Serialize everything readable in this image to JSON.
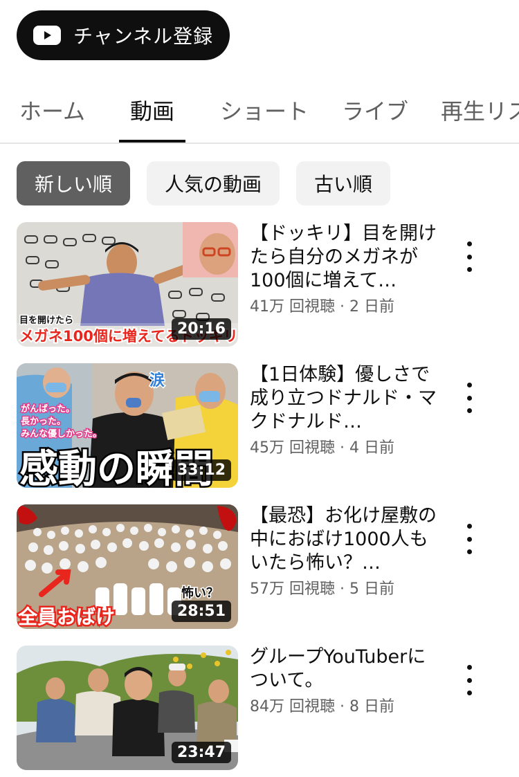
{
  "header": {
    "subscribe_label": "チャンネル登録"
  },
  "tabs": [
    {
      "label": "ホーム"
    },
    {
      "label": "動画"
    },
    {
      "label": "ショート"
    },
    {
      "label": "ライブ"
    },
    {
      "label": "再生リスト"
    }
  ],
  "chips": [
    {
      "label": "新しい順"
    },
    {
      "label": "人気の動画"
    },
    {
      "label": "古い順"
    }
  ],
  "videos": [
    {
      "title": "【ドッキリ】目を開けたら自分のメガネが100個に増えて…",
      "views": "41万 回視聴",
      "age": "2 日前",
      "duration": "20:16",
      "thumb_top_text": "目を開けたら",
      "thumb_caption": "メガネ100個に増えてるドッキリ"
    },
    {
      "title": "【1日体験】優しさで成り立つドナルド・マクドナルド…",
      "views": "45万 回視聴",
      "age": "4 日前",
      "duration": "33:12",
      "thumb_caption": "感動の瞬間",
      "thumb_lines": [
        "がんばった。",
        "長かった。",
        "みんな優しかった。"
      ],
      "thumb_tag": "涙"
    },
    {
      "title": "【最恐】お化け屋敷の中におばけ1000人もいたら怖い？…",
      "views": "57万 回視聴",
      "age": "5 日前",
      "duration": "28:51",
      "thumb_caption": "全員おばけ",
      "thumb_side": "怖い？"
    },
    {
      "title": "グループYouTuberについて。",
      "views": "84万 回視聴",
      "age": "8 日前",
      "duration": "23:47"
    }
  ]
}
